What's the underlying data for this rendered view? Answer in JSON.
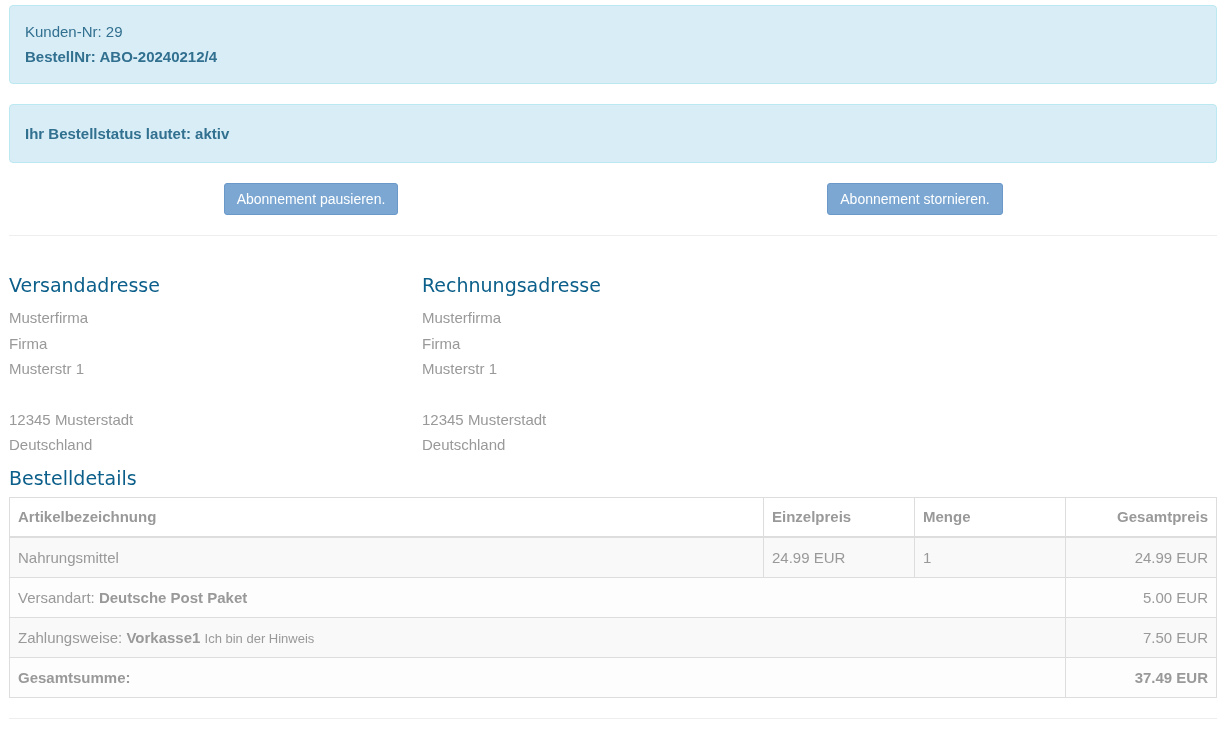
{
  "customer_info": {
    "customer_number": "Kunden-Nr: 29",
    "order_number": "BestellNr: ABO-20240212/4"
  },
  "status_message": "Ihr Bestellstatus lautet: aktiv",
  "actions": [
    "Abonnement pausieren.",
    "Abonnement stornieren."
  ],
  "addresses": [
    {
      "title": "Versandadresse",
      "blocks": [
        [
          "Musterfirma",
          "Firma",
          "Musterstr 1"
        ],
        [
          "12345 Musterstadt",
          "Deutschland"
        ]
      ]
    },
    {
      "title": "Rechnungsadresse",
      "blocks": [
        [
          "Musterfirma",
          "Firma",
          "Musterstr 1"
        ],
        [
          "12345 Musterstadt",
          "Deutschland"
        ]
      ]
    }
  ],
  "order_details": {
    "title": "Bestelldetails",
    "columns": [
      "Artikelbezeichnung",
      "Einzelpreis",
      "Menge",
      "Gesamtpreis"
    ],
    "rows": [
      {
        "kind": "item",
        "cells": [
          "Nahrungsmittel",
          "24.99 EUR",
          "1",
          "24.99 EUR"
        ]
      },
      {
        "kind": "summary",
        "label": "Versandart: **Deutsche Post Paket**",
        "value": "5.00 EUR"
      },
      {
        "kind": "summary",
        "label": "Zahlungsweise: **Vorkasse1**",
        "note": "Ich bin der Hinweis",
        "value": "7.50 EUR"
      },
      {
        "kind": "total",
        "label": "Gesamtsumme:",
        "value": "37.49 EUR"
      }
    ]
  }
}
